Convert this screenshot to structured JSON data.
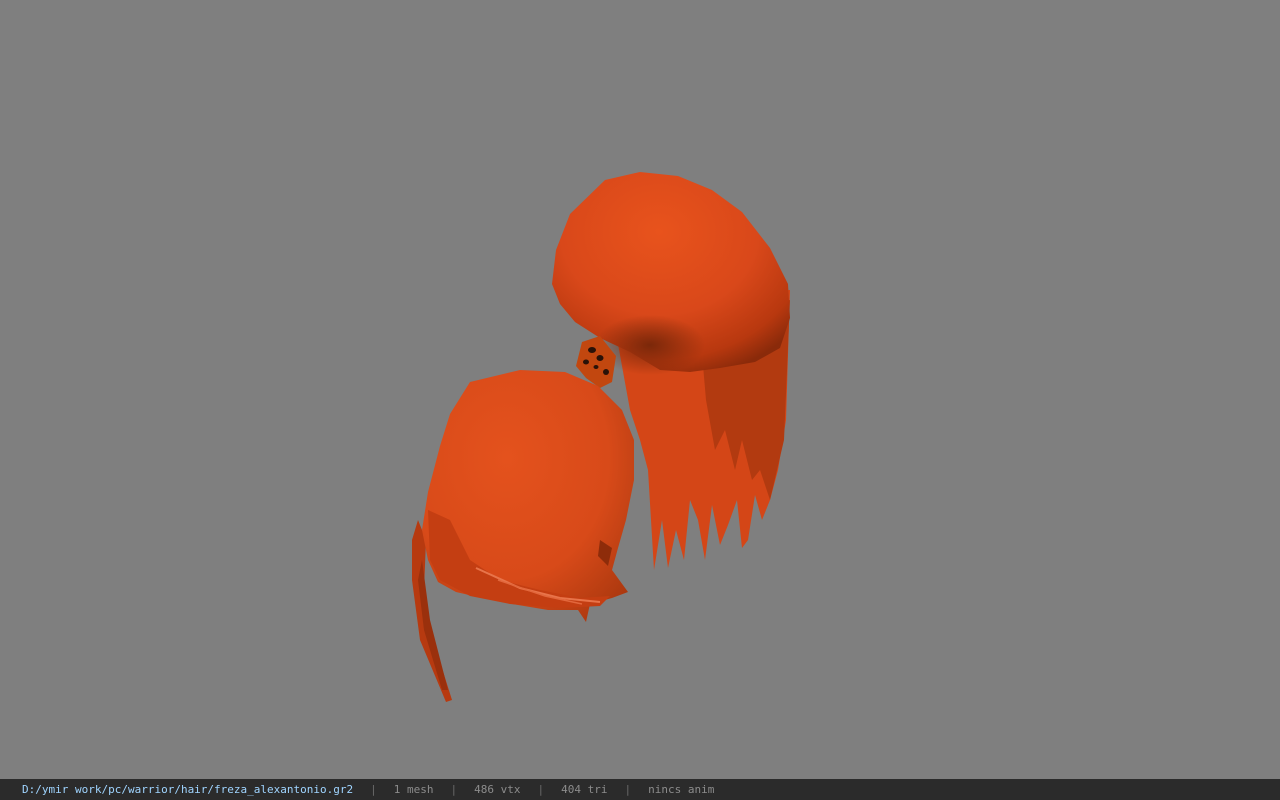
{
  "viewer": {
    "background_color": "#7f7f7f",
    "model": {
      "name": "freza_alexantonio",
      "hair_color": "#e0501f",
      "shadow_color": "#9a2e0c",
      "tie_color": "#5a2a10"
    }
  },
  "status_bar": {
    "file_path": "D:/ymir work/pc/warrior/hair/freza_alexantonio.gr2",
    "separator": "|",
    "mesh_count": "1 mesh",
    "vertex_count": "486 vtx",
    "triangle_count": "404 tri",
    "anim_status": "nincs anim",
    "path_color": "#9fd4ff",
    "bg_color": "#2b2b2b"
  }
}
